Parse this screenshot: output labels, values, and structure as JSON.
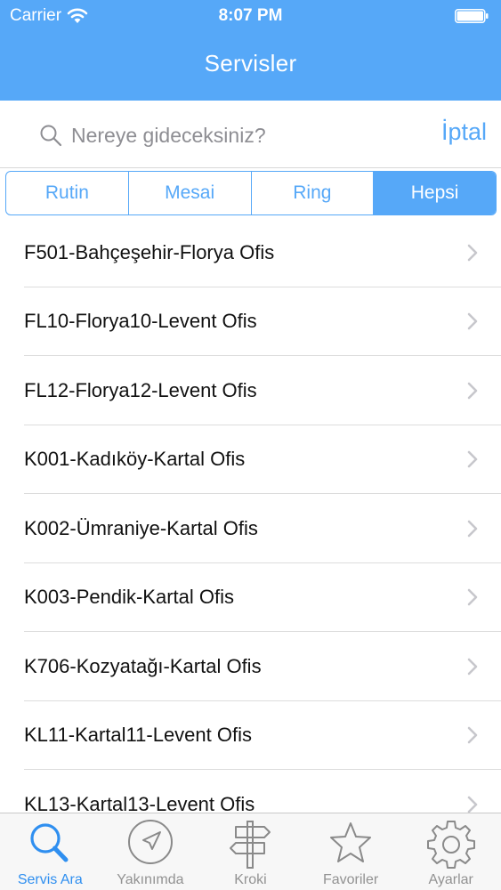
{
  "status_bar": {
    "carrier": "Carrier",
    "time": "8:07 PM"
  },
  "nav": {
    "title": "Servisler"
  },
  "search": {
    "placeholder": "Nereye gideceksiniz?",
    "value": "",
    "cancel_label": "İptal"
  },
  "segments": [
    {
      "label": "Rutin",
      "selected": false
    },
    {
      "label": "Mesai",
      "selected": false
    },
    {
      "label": "Ring",
      "selected": false
    },
    {
      "label": "Hepsi",
      "selected": true
    }
  ],
  "routes": [
    "F501-Bahçeşehir-Florya Ofis",
    "FL10-Florya10-Levent Ofis",
    "FL12-Florya12-Levent Ofis",
    "K001-Kadıköy-Kartal Ofis",
    "K002-Ümraniye-Kartal Ofis",
    "K003-Pendik-Kartal Ofis",
    "K706-Kozyatağı-Kartal Ofis",
    "KL11-Kartal11-Levent Ofis",
    "KL13-Kartal13-Levent Ofis"
  ],
  "tabs": [
    {
      "label": "Servis Ara",
      "icon": "magnifier-icon",
      "active": true
    },
    {
      "label": "Yakınımda",
      "icon": "compass-icon",
      "active": false
    },
    {
      "label": "Kroki",
      "icon": "signpost-icon",
      "active": false
    },
    {
      "label": "Favoriler",
      "icon": "star-icon",
      "active": false
    },
    {
      "label": "Ayarlar",
      "icon": "gear-icon",
      "active": false
    }
  ],
  "colors": {
    "accent": "#56a8f8",
    "tab_active": "#2f8ff0",
    "tab_inactive": "#929292"
  }
}
